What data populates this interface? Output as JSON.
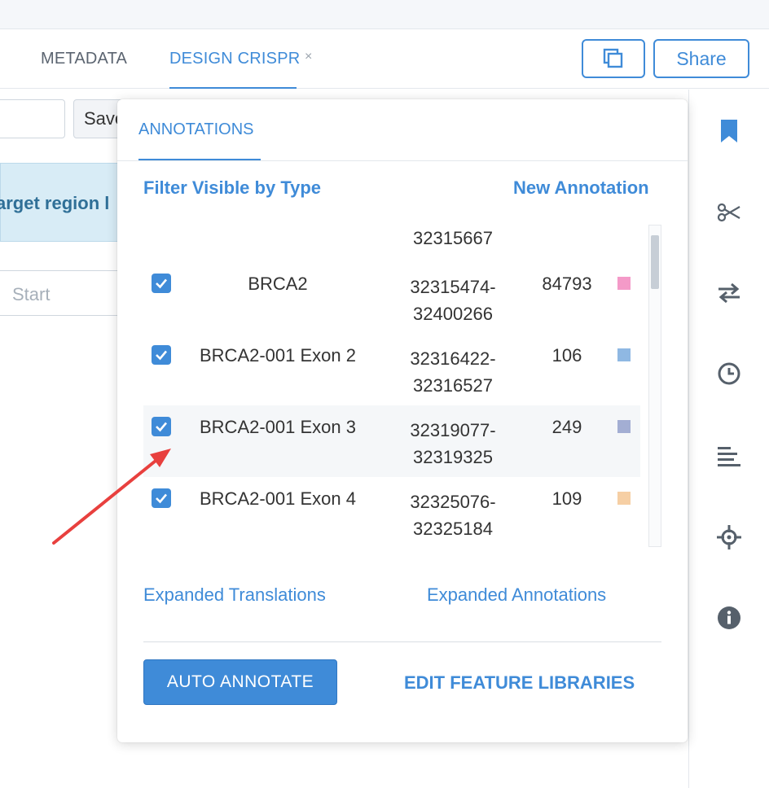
{
  "tabs": [
    {
      "label": "METADATA"
    },
    {
      "label": "DESIGN CRISPR",
      "close": "×"
    }
  ],
  "header": {
    "share_label": "Share"
  },
  "left": {
    "save_label": "Save",
    "banner_text": "arget region l",
    "start_placeholder": "Start"
  },
  "panel": {
    "tab_label": "ANNOTATIONS",
    "filter_label": "Filter Visible by Type",
    "new_label": "New Annotation",
    "partial_range": "32315667",
    "rows": [
      {
        "name": "BRCA2",
        "range_start": "32315474-",
        "range_end": "32400266",
        "length": "84793",
        "color": "#f49ac8",
        "checked": true
      },
      {
        "name": "BRCA2-001 Exon 2",
        "range_start": "32316422-",
        "range_end": "32316527",
        "length": "106",
        "color": "#8fb8e3",
        "checked": true
      },
      {
        "name": "BRCA2-001 Exon 3",
        "range_start": "32319077-",
        "range_end": "32319325",
        "length": "249",
        "color": "#a3aed3",
        "checked": true
      },
      {
        "name": "BRCA2-001 Exon 4",
        "range_start": "32325076-",
        "range_end": "32325184",
        "length": "109",
        "color": "#f6cfa4",
        "checked": true
      }
    ],
    "expanded_translations": "Expanded Translations",
    "expanded_annotations": "Expanded Annotations",
    "auto_annotate": "AUTO ANNOTATE",
    "edit_libraries": "EDIT FEATURE LIBRARIES"
  },
  "sidebar": [
    {
      "icon": "bookmark-icon"
    },
    {
      "icon": "scissors-icon"
    },
    {
      "icon": "swap-arrows-icon"
    },
    {
      "icon": "clock-icon"
    },
    {
      "icon": "align-left-icon"
    },
    {
      "icon": "crosshair-icon"
    },
    {
      "icon": "info-icon"
    }
  ],
  "colors": {
    "accent": "#3f8bd8",
    "annotation_arrow": "#e8403e"
  }
}
